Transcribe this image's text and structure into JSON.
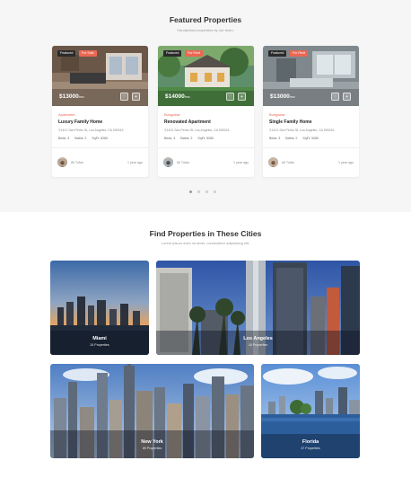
{
  "featured": {
    "title": "Featured Properties",
    "subtitle": "Handpicked properties by our team.",
    "cards": [
      {
        "tag_featured": "Featured",
        "tag_status": "For Sale",
        "price": "$13000",
        "price_unit": "/mo",
        "category": "Apartment",
        "title": "Luxury Family Home",
        "address": "1421 San Pedro St, Los Angeles, CA 900015",
        "beds": "Beds: 3",
        "baths": "Baths: 2",
        "sqft": "SqFt: 5280",
        "author": "Ali Tufan",
        "ago": "1 year ago"
      },
      {
        "tag_featured": "Featured",
        "tag_status": "For Rent",
        "price": "$14000",
        "price_unit": "/mo",
        "category": "Bungalow",
        "title": "Renovated Apartment",
        "address": "1421 San Pedro St, Los Angeles, CA 900015",
        "beds": "Beds: 3",
        "baths": "Baths: 2",
        "sqft": "SqFt: 5280",
        "author": "Ali Tufan",
        "ago": "1 year ago"
      },
      {
        "tag_featured": "Featured",
        "tag_status": "For Rent",
        "price": "$13000",
        "price_unit": "/mo",
        "category": "Bungalow",
        "title": "Single Family Home",
        "address": "1421 San Pedro St, Los Angeles, CA 900015",
        "beds": "Beds: 3",
        "baths": "Baths: 2",
        "sqft": "SqFt: 5280",
        "author": "Ali Tufan",
        "ago": "1 year ago"
      }
    ]
  },
  "cities": {
    "title": "Find Properties in These Cities",
    "subtitle": "Lorem ipsum dolor sit amet, consectetur adipisicing elit.",
    "items": [
      {
        "name": "Miami",
        "count": "24 Properties"
      },
      {
        "name": "Los Angeles",
        "count": "18 Properties"
      },
      {
        "name": "New York",
        "count": "89 Properties"
      },
      {
        "name": "Florida",
        "count": "47 Properties"
      }
    ]
  },
  "colors": {
    "accent": "#eb6753",
    "dark": "#2b2b2b",
    "section_bg": "#f6f6f6"
  },
  "icons": {
    "favorite": "heart-icon",
    "compare": "plus-icon",
    "location": "location-pin-icon"
  }
}
